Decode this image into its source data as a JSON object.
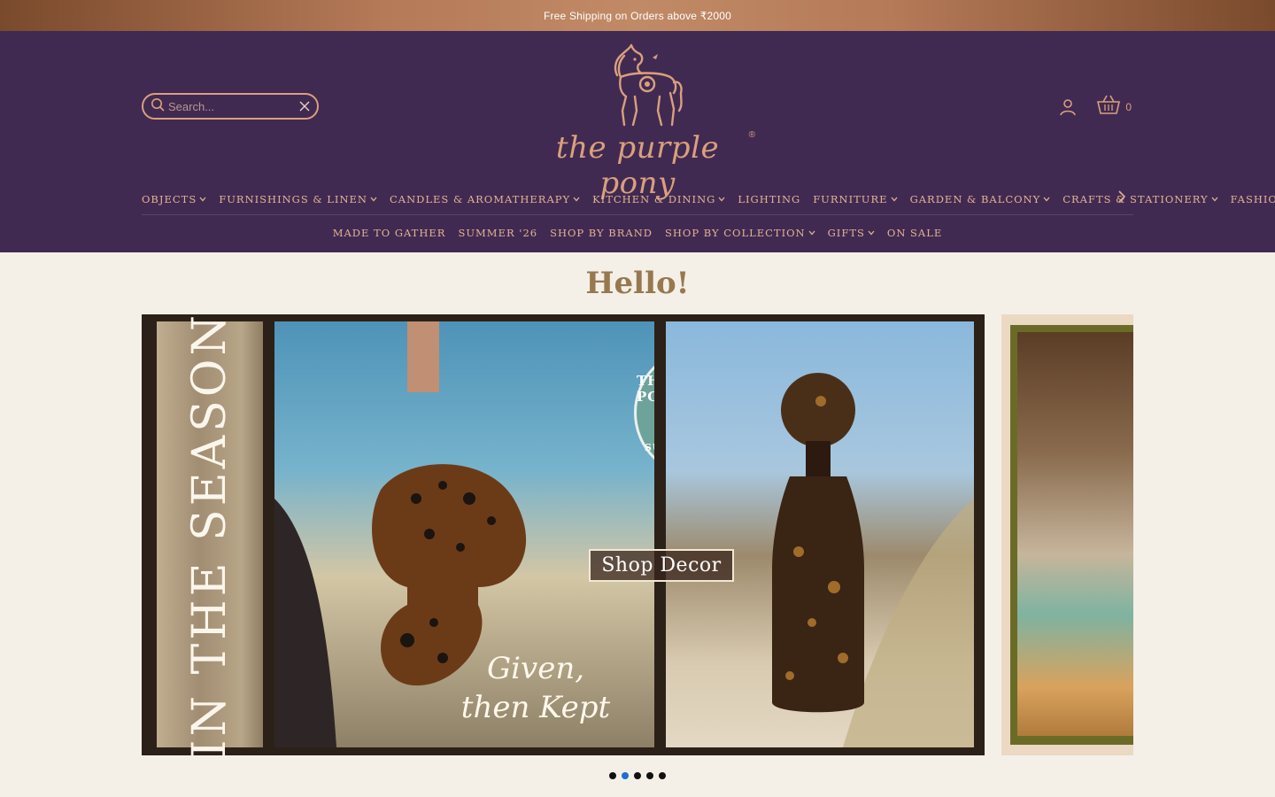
{
  "announcement": "Free Shipping on Orders above ₹2000",
  "search": {
    "placeholder": "Search..."
  },
  "brand": {
    "name": "the purple pony",
    "registered": "®"
  },
  "cart": {
    "count": "0"
  },
  "nav_primary": [
    {
      "label": "OBJECTS",
      "dropdown": true
    },
    {
      "label": "FURNISHINGS & LINEN",
      "dropdown": true
    },
    {
      "label": "CANDLES & AROMATHERAPY",
      "dropdown": true
    },
    {
      "label": "KITCHEN & DINING",
      "dropdown": true
    },
    {
      "label": "LIGHTING",
      "dropdown": false
    },
    {
      "label": "FURNITURE",
      "dropdown": true
    },
    {
      "label": "GARDEN & BALCONY",
      "dropdown": true
    },
    {
      "label": "CRAFTS & STATIONERY",
      "dropdown": true
    },
    {
      "label": "FASHION",
      "dropdown": true
    }
  ],
  "nav_secondary": [
    {
      "label": "MADE TO GATHER",
      "dropdown": false
    },
    {
      "label": "SUMMER '26",
      "dropdown": false
    },
    {
      "label": "SHOP BY BRAND",
      "dropdown": false
    },
    {
      "label": "SHOP BY COLLECTION",
      "dropdown": true
    },
    {
      "label": "GIFTS",
      "dropdown": true
    },
    {
      "label": "ON SALE",
      "dropdown": false
    }
  ],
  "greeting": "Hello!",
  "banner": {
    "vertical_text": "IN THE SEASON",
    "seal_top": "THE PURPLE PONY",
    "seal_bottom": "SUMMER LIVING",
    "cta": "Shop Decor",
    "tagline_line1": "Given,",
    "tagline_line2": "then Kept"
  },
  "carousel": {
    "slides": 5,
    "active_index": 1
  },
  "colors": {
    "header_bg": "#412a52",
    "accent": "#d9a07c",
    "page_bg": "#f4f0e8",
    "active_dot": "#1e6fd2"
  }
}
